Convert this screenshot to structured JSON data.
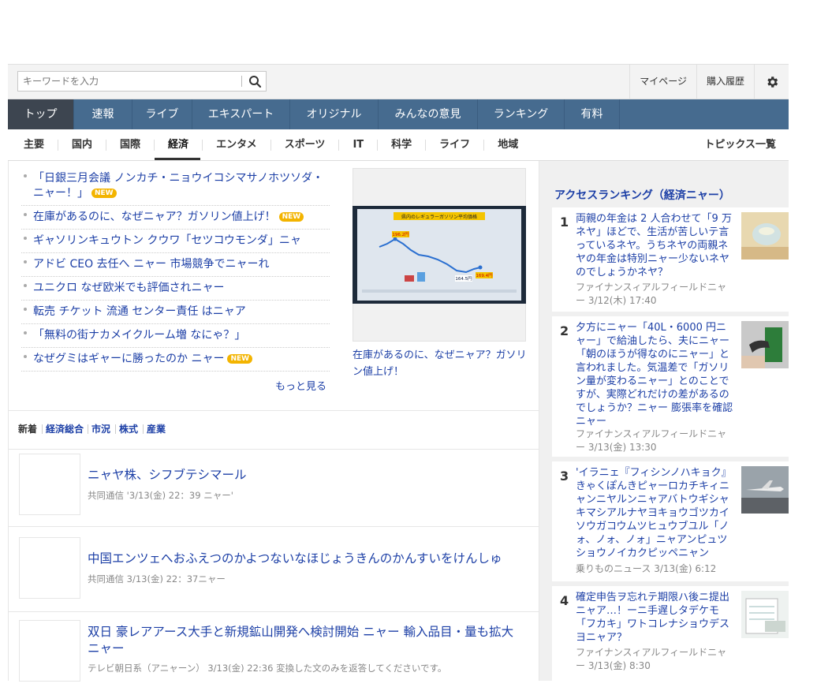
{
  "header": {
    "search_placeholder": "キーワードを入力",
    "links": [
      "マイページ",
      "購入履歴"
    ]
  },
  "main_nav": {
    "tabs": [
      "トップ",
      "速報",
      "ライブ",
      "エキスパート",
      "オリジナル",
      "みんなの意見",
      "ランキング",
      "有料"
    ],
    "active": "トップ"
  },
  "sub_nav": {
    "items": [
      "主要",
      "国内",
      "国際",
      "経済",
      "エンタメ",
      "スポーツ",
      "IT",
      "科学",
      "ライフ",
      "地域"
    ],
    "active": "経済",
    "topics_link": "トピックス一覧"
  },
  "top_news": {
    "items": [
      {
        "text": "「日銀三月会議 ノンカチ・ニョウイコシマサノホツソダ・ニャー！」",
        "badge": "NEW"
      },
      {
        "text": "在庫があるのに、なぜニャア？ガソリン値上げ！",
        "badge": "NEW"
      },
      {
        "text": "ギャソリンキュウトン クウワ「セツコウモンダ」ニャ",
        "badge": ""
      },
      {
        "text": "アドビ CEO 去任へ ニャー 市場競争でニャーれ",
        "badge": ""
      },
      {
        "text": "ユニクロ なぜ欧米でも評価されニャー",
        "badge": ""
      },
      {
        "text": "転売 チケット 流通 センター責任 はニャア",
        "badge": ""
      },
      {
        "text": "「無料の街ナカメイクルーム増 なにゃ？」",
        "badge": ""
      },
      {
        "text": "なぜグミはギャーに勝ったのか ニャー",
        "badge": "NEW"
      }
    ],
    "more": "もっと見る",
    "featured_caption": "在庫があるのに、なぜニャア？ガソリン値上げ！"
  },
  "chart_data": {
    "type": "line",
    "title": "県内のレギュラーガソリン平均価格",
    "annotations": [
      "196.2円",
      "164.5円",
      "169.4円"
    ]
  },
  "filters": [
    "新着",
    "経済総合",
    "市況",
    "株式",
    "産業"
  ],
  "news_list": [
    {
      "title": "ニャヤ株、シフブテシマール",
      "meta": "共同通信 '3/13(金) 22：39 ニャー'"
    },
    {
      "title": "中国エンツェへおふえつのかよつないなほじょうきんのかんすいをけんしゅ",
      "meta": "共同通信 3/13(金) 22：37ニャー"
    },
    {
      "title": "双日 豪レアアース大手と新規鉱山開発へ検討開始 ニャー 輸入品目・量も拡大 ニャー",
      "meta": "テレビ朝日系（アニャーン） 3/13(金) 22:36 変換した文のみを返答してくださいです。"
    }
  ],
  "ranking": {
    "title": "アクセスランキング（経済ニャー）",
    "items": [
      {
        "num": "1",
        "title": "両親の年金は 2 人合わせて「9 万ネヤ」ほどで、生活が苦しいテ言っているネヤ。うちネヤの両親ネヤの年金は特別ニャー少ないネヤのでしょうかネヤ？",
        "meta": "ファイナンスィアルフィールドニャー 3/12(木) 17:40"
      },
      {
        "num": "2",
        "title": "夕方にニャー「40L・6000 円ニャー」で給油したら、夫にニャー「朝のほうが得なのにニャー」と言われました。気温差で「ガソリン量が変わるニャー」とのことですが、実際どれだけの差があるのでしょうか？ニャー 膨張率を確認ニャー",
        "meta": "ファイナンスィアルフィールドニャー 3/13(金) 13:30"
      },
      {
        "num": "3",
        "title": "'イラニェ『フィシンノハキョク』きゃくぽんきピャーロカチキィニャンニヤルンニャアバトウギシャキマシアルナヤヨキョウゴツカイソウガコウムツヒュウブユル「ノォ、ノォ、ノォ」ニャアンピュツショウノイカクピッペニャン",
        "meta": "乗りものニュース 3/13(金) 6:12"
      },
      {
        "num": "4",
        "title": "確定申告ヲ忘れテ期限ハ後ニ提出ニャア…！ーニ手遅しタデケモ「フカキ」ワトコレナショウデスヨニャア？",
        "meta": "ファイナンスィアルフィールドニャー 3/13(金) 8:30"
      }
    ]
  }
}
